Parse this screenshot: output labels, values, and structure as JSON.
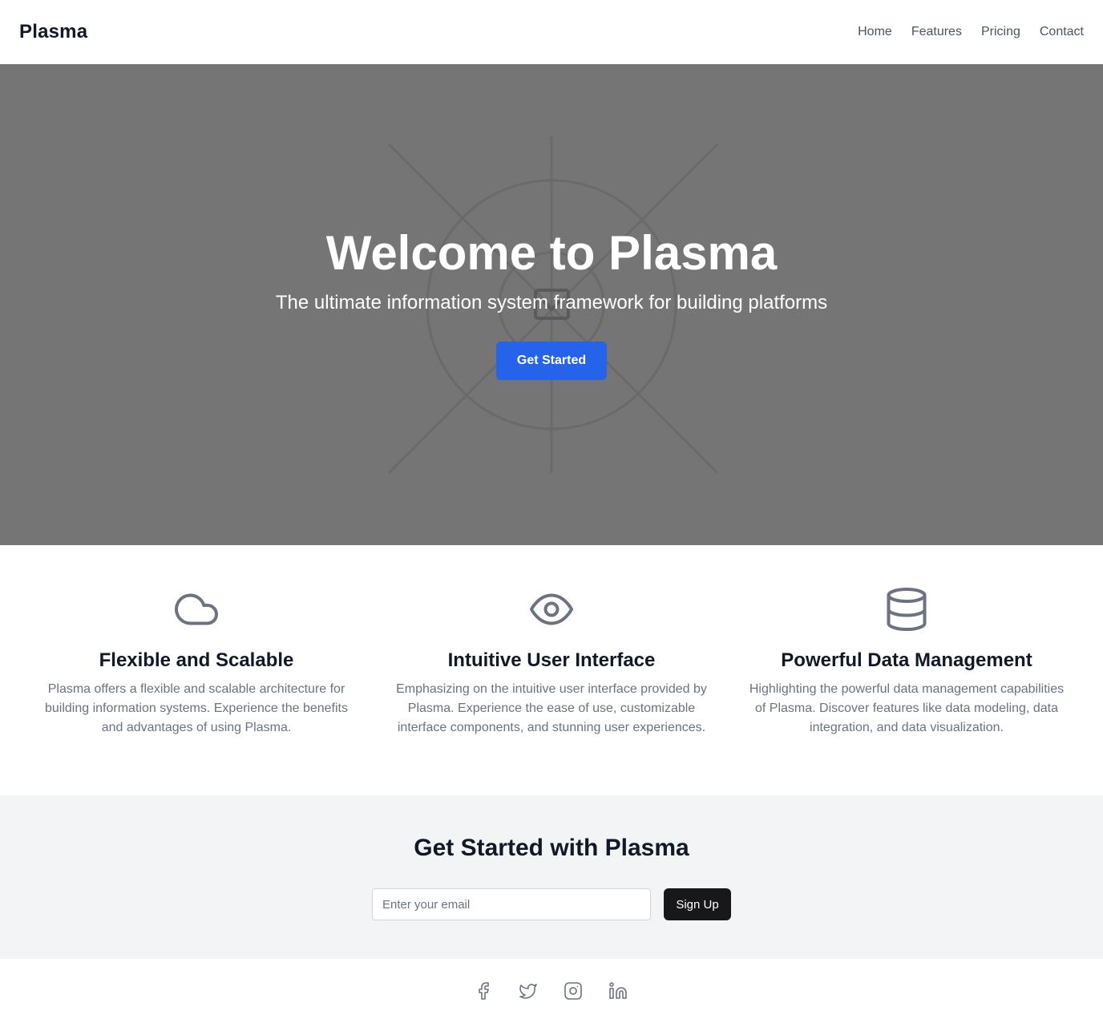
{
  "header": {
    "brand": "Plasma",
    "nav": [
      "Home",
      "Features",
      "Pricing",
      "Contact"
    ]
  },
  "hero": {
    "title": "Welcome to Plasma",
    "subtitle": "The ultimate information system framework for building platforms",
    "cta_label": "Get Started"
  },
  "features": [
    {
      "icon": "cloud-icon",
      "title": "Flexible and Scalable",
      "description": "Plasma offers a flexible and scalable architecture for building information systems. Experience the benefits and advantages of using Plasma."
    },
    {
      "icon": "eye-icon",
      "title": "Intuitive User Interface",
      "description": "Emphasizing on the intuitive user interface provided by Plasma. Experience the ease of use, customizable interface components, and stunning user experiences."
    },
    {
      "icon": "database-icon",
      "title": "Powerful Data Management",
      "description": "Highlighting the powerful data management capabilities of Plasma. Discover features like data modeling, data integration, and data visualization."
    }
  ],
  "signup": {
    "title": "Get Started with Plasma",
    "email_placeholder": "Enter your email",
    "email_value": "",
    "button_label": "Sign Up"
  },
  "footer": {
    "socials": [
      "facebook-icon",
      "twitter-icon",
      "instagram-icon",
      "linkedin-icon"
    ]
  },
  "colors": {
    "primary_button": "#2563eb",
    "hero_background": "#757575",
    "signup_button": "#18181b",
    "icon_gray": "#6b7280"
  }
}
